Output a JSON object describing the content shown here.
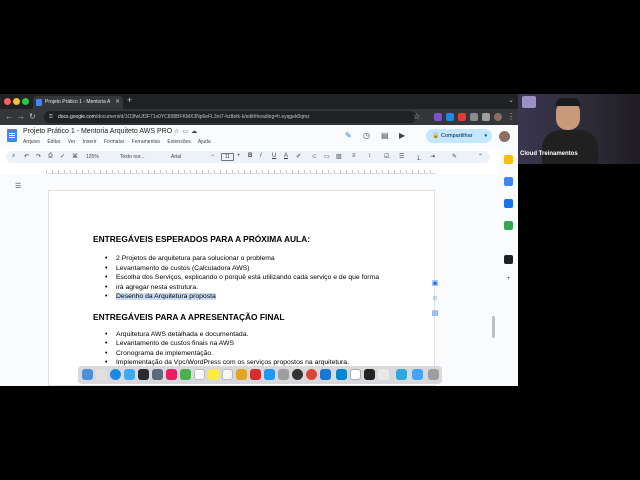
{
  "browser": {
    "tab_title": "Projeto Prático 1 - Mentoria A",
    "tab_close": "✕",
    "new_tab": "+",
    "url_domain": "docs.google.com",
    "url_path": "/document/d/1O3fwUf3F71x0YC898BFKMX3Np6eFL3nI7-hz8etk-k/edit#heading=h.eyqgek0qmz"
  },
  "docs": {
    "title": "Projeto Prático 1 - Mentoria Arquiteto AWS PRO",
    "menus": [
      "Arquivo",
      "Editar",
      "Ver",
      "Inserir",
      "Formatar",
      "Ferramentas",
      "Extensões",
      "Ajuda"
    ],
    "share_label": "Compartilhar",
    "toolbar": {
      "zoom": "125%",
      "style": "Texto nor...",
      "font": "Arial",
      "font_size": "11"
    }
  },
  "document": {
    "heading1": "ENTREGÁVEIS ESPERADOS PARA A PRÓXIMA AULA:",
    "list1": [
      "2 Projetos de arquitetura para solucionar o problema",
      "Levantamento de custos (Calculadora AWS)",
      "Escolha dos Serviços, explicando o porquê está utilizando cada serviço e de que forma",
      "irá agregar nesta estrutura.",
      "Desenho da Arquitetura proposta"
    ],
    "heading2": "ENTREGÁVEIS PARA A APRESENTAÇÃO FINAL",
    "list2": [
      "Arquitetura AWS detalhada e documentada.",
      "Levantamento de custos finais na AWS",
      "Cronograma de implementação.",
      "Implementação da Vpc/WordPress com os serviços propostos na arquitetura."
    ]
  },
  "video": {
    "participant_name": "Cloud Treinamentos"
  },
  "colors": {
    "share_bg": "#c2e7ff",
    "highlight": "#c9dcf7",
    "toolbar_bg": "#edf2fa"
  },
  "icons": [
    "back-icon",
    "forward-icon",
    "reload-icon",
    "lock-icon",
    "docs-icon",
    "star-icon",
    "history-icon",
    "comment-icon",
    "meet-icon",
    "search-icon",
    "undo-icon",
    "redo-icon",
    "print-icon",
    "bold-icon",
    "italic-icon",
    "underline-icon",
    "outline-icon"
  ]
}
